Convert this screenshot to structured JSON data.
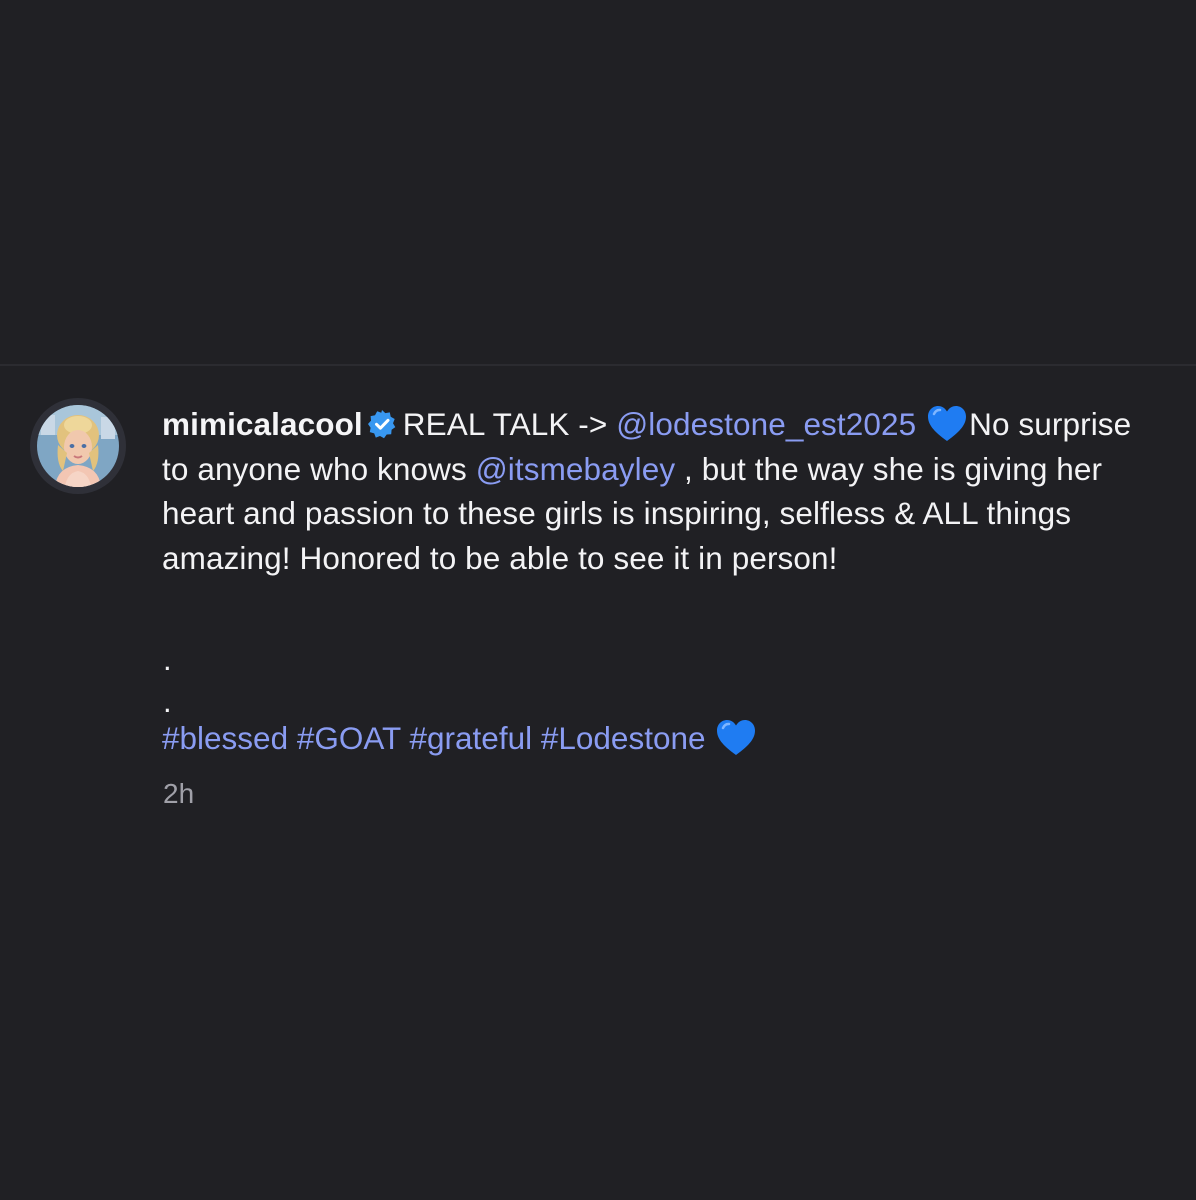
{
  "post": {
    "username": "mimicalacool",
    "caption_lead": "REAL TALK -> ",
    "mention_1": "@lodestone_est2025",
    "caption_2": "No surprise to anyone who knows ",
    "mention_2": "@itsmebayley",
    "caption_3": " , but the way she is giving her heart and passion to these girls is inspiring, selfless & ALL things amazing! Honored to be able to see it in person!",
    "dot_1": ".",
    "dot_2": ".",
    "hashtags": [
      "#blessed",
      "#GOAT",
      "#grateful",
      "#Lodestone"
    ],
    "timestamp": "2h"
  },
  "icons": {
    "verified": "verified-badge-icon",
    "heart": "blue-heart-emoji"
  },
  "colors": {
    "background": "#202024",
    "text": "#f3f3f5",
    "link": "#8a9cf2",
    "verified": "#3897f0",
    "heart": "#1f7cf2",
    "timestamp": "#a0a0a8"
  }
}
